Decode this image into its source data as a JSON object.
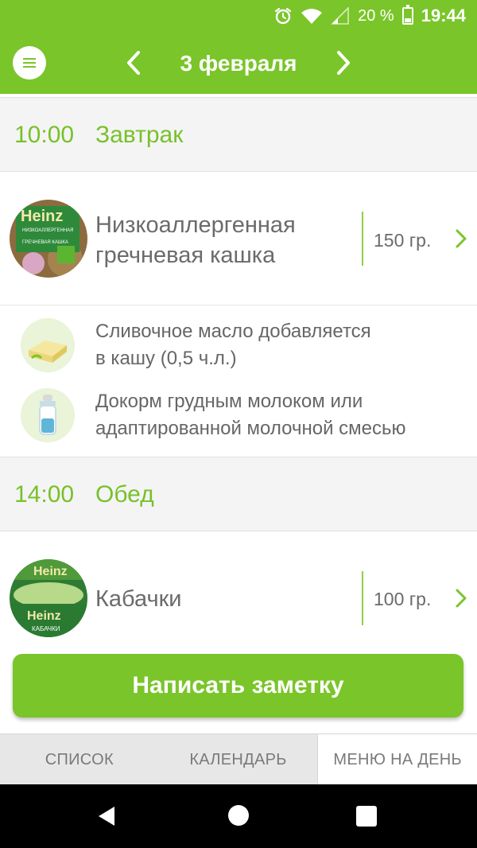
{
  "status_bar": {
    "battery_percent": "20 %",
    "time": "19:44"
  },
  "header": {
    "date": "3 февраля"
  },
  "meals": [
    {
      "time": "10:00",
      "title": "Завтрак",
      "product": {
        "name_line1": "Низкоаллергенная",
        "name_line2": "гречневая кашка",
        "weight": "150 гр.",
        "package_brand": "Heinz",
        "package_caption": "НИЗКОАЛЛЕРГЕННАЯ",
        "package_product": "ГРЕЧНЕВАЯ КАШКА"
      },
      "tips": [
        {
          "line1": "Сливочное масло добавляется",
          "line2": "в кашу (0,5 ч.л.)"
        },
        {
          "line1": "Докорм грудным молоком или",
          "line2": "адаптированной молочной смесью"
        }
      ]
    },
    {
      "time": "14:00",
      "title": "Обед",
      "product": {
        "name": "Кабачки",
        "weight": "100 гр.",
        "package_brand": "Heinz",
        "package_product": "КАБАЧКИ"
      }
    }
  ],
  "note_button": "Написать заметку",
  "tabs": [
    "СПИСОК",
    "КАЛЕНДАРЬ",
    "МЕНЮ НА ДЕНЬ"
  ],
  "colors": {
    "accent": "#7ac52a",
    "text": "#6b6b6b"
  }
}
